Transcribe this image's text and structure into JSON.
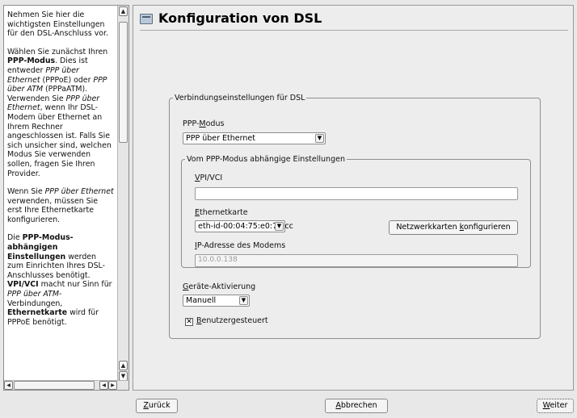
{
  "help": {
    "p1": "Nehmen Sie hier die wichtigsten Einstellungen für den DSL-Anschluss vor.",
    "p2_intro": "Wählen Sie zunächst Ihren ",
    "p2_bold": "PPP-Modus",
    "p2_a": ". Dies ist entweder ",
    "p2_em1": "PPP über Ethernet",
    "p2_b": " (PPPoE) oder ",
    "p2_em2": "PPP über ATM",
    "p2_c": " (PPPaATM). Verwenden Sie ",
    "p2_em3": "PPP über Ethernet",
    "p2_d": ", wenn Ihr DSL-Modem über Ethernet an Ihrem Rechner angeschlossen ist. Falls Sie sich unsicher sind, welchen Modus Sie verwenden sollen, fragen Sie Ihren Provider.",
    "p3_a": "Wenn Sie ",
    "p3_em": "PPP über Ethernet",
    "p3_b": " verwenden, müssen Sie erst Ihre Ethernetkarte konfigurieren.",
    "p4_a": "Die ",
    "p4_bold": "PPP-Modus-abhängigen Einstellungen",
    "p4_b": " werden zum Einrichten Ihres DSL-Anschlusses benötigt. ",
    "p4_bold2": "VPI/VCI",
    "p4_c": " macht nur Sinn für ",
    "p4_em": "PPP über ATM",
    "p4_d": "-Verbindungen, ",
    "p4_bold3": "Ethernetkarte",
    "p4_e": " wird für PPPoE benötigt."
  },
  "page": {
    "title": "Konfiguration von DSL"
  },
  "connection": {
    "legend": "Verbindungseinstellungen für DSL",
    "ppp_mode_label_a": "PPP-",
    "ppp_mode_label_u": "M",
    "ppp_mode_label_b": "odus",
    "ppp_mode_value": "PPP über Ethernet",
    "dependent": {
      "legend": "Vom PPP-Modus abhängige Einstellungen",
      "vpi_label_u": "V",
      "vpi_label_b": "PI/VCI",
      "vpi_value": "",
      "eth_label_u": "E",
      "eth_label_b": "thernetkarte",
      "eth_value": "eth-id-00:04:75:e0:76:cc",
      "configure_btn_a": "Netzwerkkarten ",
      "configure_btn_u": "k",
      "configure_btn_b": "onfigurieren",
      "ip_label_u": "I",
      "ip_label_b": "P-Adresse des Modems",
      "ip_value": "10.0.0.138"
    },
    "activation_label_u": "G",
    "activation_label_b": "eräte-Aktivierung",
    "activation_value": "Manuell",
    "user_controlled_u": "B",
    "user_controlled_b": "enutzergesteuert",
    "user_controlled_checked": true
  },
  "footer": {
    "back_u": "Z",
    "back_b": "urück",
    "cancel_u": "A",
    "cancel_b": "bbrechen",
    "next_u": "W",
    "next_b": "eiter"
  },
  "icons": {
    "page_title_icon": "dsl-modem-icon",
    "dropdown": "chevron-down-icon"
  }
}
